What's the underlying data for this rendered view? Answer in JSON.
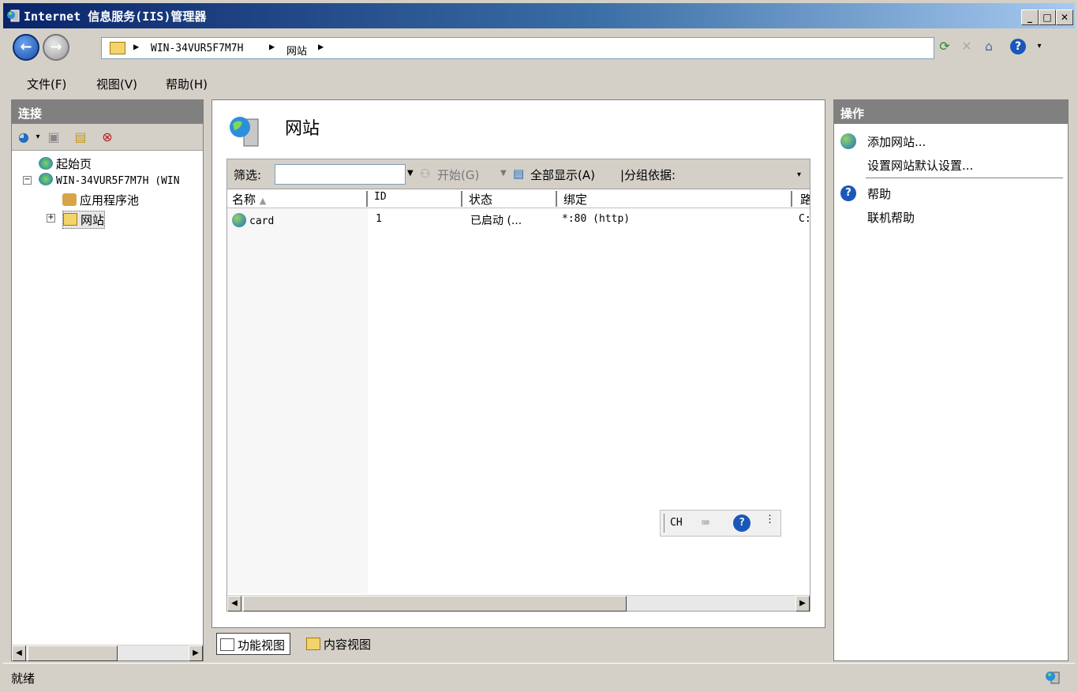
{
  "window": {
    "title": "Internet 信息服务(IIS)管理器",
    "minimize": "_",
    "maximize": "□",
    "close": "✕"
  },
  "address": {
    "crumbs": [
      "WIN-34VUR5F7M7H",
      "网站"
    ]
  },
  "menu": {
    "items": [
      "文件(F)",
      "视图(V)",
      "帮助(H)"
    ]
  },
  "connections": {
    "header": "连接",
    "tree": [
      {
        "label": "起始页"
      },
      {
        "label": "WIN-34VUR5F7M7H (WIN"
      },
      {
        "label": "应用程序池"
      },
      {
        "label": "网站"
      }
    ]
  },
  "main": {
    "title": "网站",
    "filter_label": "筛选:",
    "filter_value": "",
    "start_label": "开始(G)",
    "show_all_label": "全部显示(A)",
    "group_by_label": "|分组依据:",
    "columns": [
      "名称",
      "ID",
      "状态",
      "绑定",
      "路"
    ],
    "rows": [
      {
        "name": "card",
        "id": "1",
        "status": "已启动 (...",
        "binding": "*:80 (http)",
        "path": "C:"
      }
    ],
    "ime_label": "CH"
  },
  "view_tabs": {
    "features": "功能视图",
    "content": "内容视图"
  },
  "actions": {
    "header": "操作",
    "add_site": "添加网站...",
    "set_defaults": "设置网站默认设置...",
    "help": "帮助",
    "online_help": "联机帮助"
  },
  "status": {
    "text": "就绪"
  }
}
